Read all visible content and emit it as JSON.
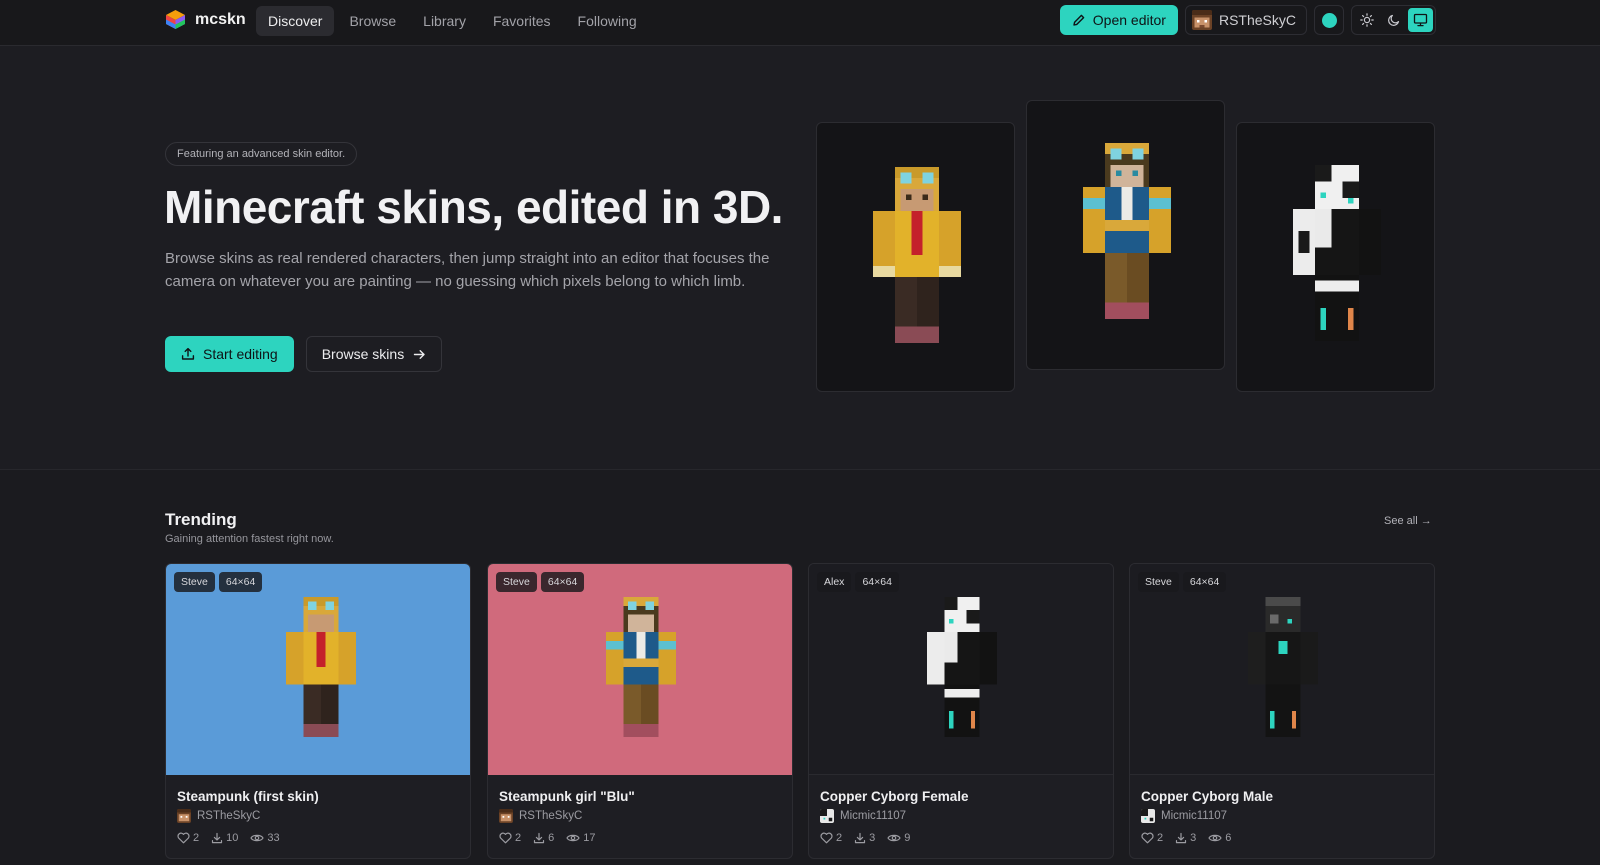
{
  "brand": {
    "name": "mcskn"
  },
  "nav": {
    "links": [
      "Discover",
      "Browse",
      "Library",
      "Favorites",
      "Following"
    ],
    "active": "Discover",
    "open_editor": "Open editor",
    "username": "RSTheSkyC",
    "accent": "#2dd4bf"
  },
  "hero": {
    "pill": "Featuring an advanced skin editor.",
    "title": "Minecraft skins, edited in 3D.",
    "description": "Browse skins as real rendered characters, then jump straight into an editor that focuses the camera on whatever you are painting — no guessing which pixels belong to which limb.",
    "start_editing": "Start editing",
    "browse_skins": "Browse skins"
  },
  "trending": {
    "title": "Trending",
    "subtitle": "Gaining attention fastest right now.",
    "see_all": "See all →",
    "cards": [
      {
        "model": "Steve",
        "size": "64×64",
        "title": "Steampunk (first skin)",
        "author": "RSTheSkyC",
        "likes": "2",
        "downloads": "10",
        "views": "33",
        "bg": "#5a9bd8"
      },
      {
        "model": "Steve",
        "size": "64×64",
        "title": "Steampunk girl \"Blu\"",
        "author": "RSTheSkyC",
        "likes": "2",
        "downloads": "6",
        "views": "17",
        "bg": "#d06a7c"
      },
      {
        "model": "Alex",
        "size": "64×64",
        "title": "Copper Cyborg Female",
        "author": "Micmic11107",
        "likes": "2",
        "downloads": "3",
        "views": "9",
        "bg": "#1c1c21"
      },
      {
        "model": "Steve",
        "size": "64×64",
        "title": "Copper Cyborg Male",
        "author": "Micmic11107",
        "likes": "2",
        "downloads": "3",
        "views": "6",
        "bg": "#1c1c21"
      }
    ]
  }
}
